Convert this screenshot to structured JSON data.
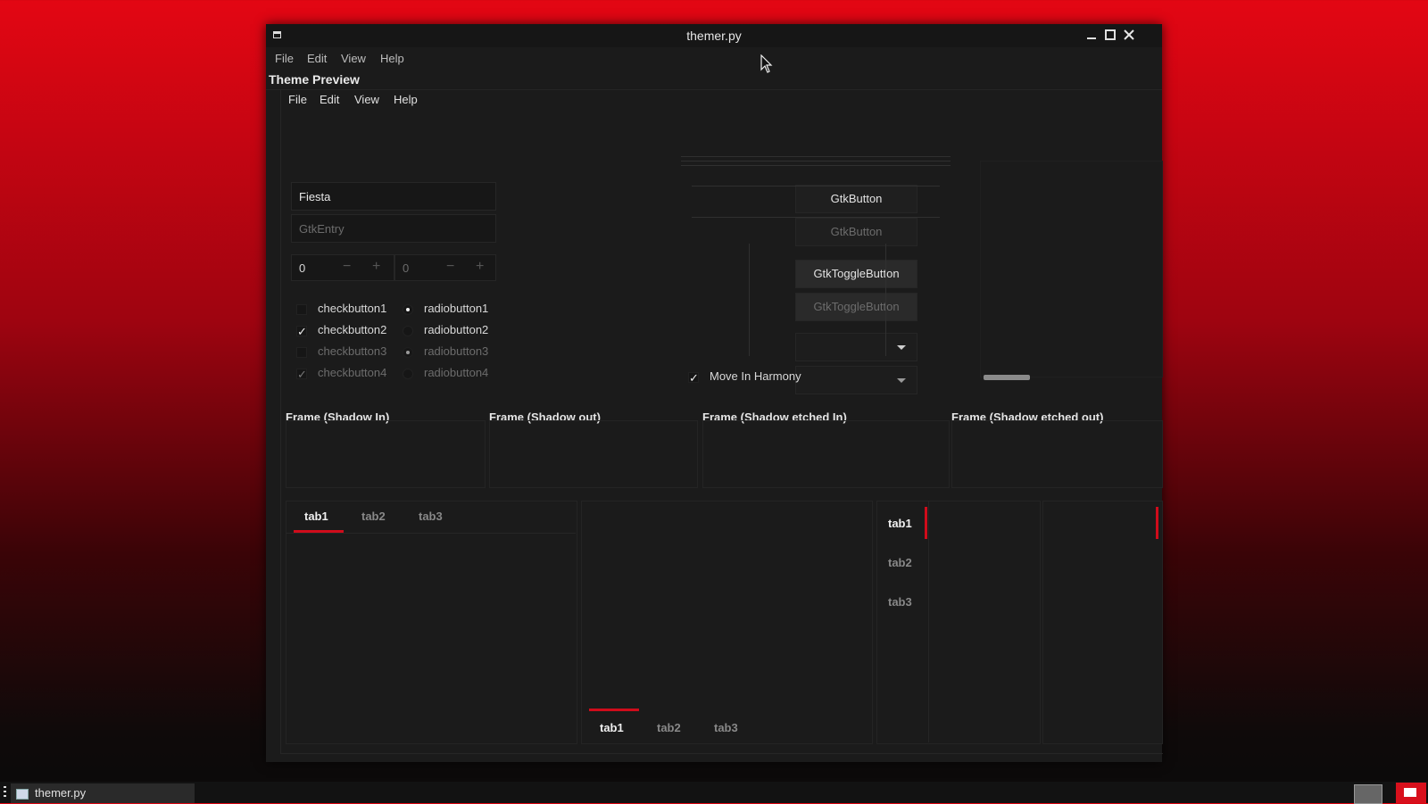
{
  "window": {
    "title": "themer.py"
  },
  "menubar": [
    "File",
    "Edit",
    "View",
    "Help"
  ],
  "preview": {
    "title": "Theme Preview",
    "menubar": [
      "File",
      "Edit",
      "View",
      "Help"
    ],
    "entries": {
      "entry1_value": "Fiesta",
      "entry2_placeholder": "GtkEntry"
    },
    "spinbuttons": [
      {
        "value": "0"
      },
      {
        "value": "0"
      }
    ],
    "checkbuttons": [
      {
        "label": "checkbutton1",
        "checked": false,
        "enabled": true
      },
      {
        "label": "checkbutton2",
        "checked": true,
        "enabled": true
      },
      {
        "label": "checkbutton3",
        "checked": false,
        "enabled": false
      },
      {
        "label": "checkbutton4",
        "checked": true,
        "enabled": false
      }
    ],
    "radiobuttons": [
      {
        "label": "radiobutton1",
        "selected": true,
        "enabled": true
      },
      {
        "label": "radiobutton2",
        "selected": false,
        "enabled": true
      },
      {
        "label": "radiobutton3",
        "selected": true,
        "enabled": false
      },
      {
        "label": "radiobutton4",
        "selected": false,
        "enabled": false
      }
    ],
    "buttons": [
      "GtkButton",
      "GtkButton"
    ],
    "toggle_buttons": [
      "GtkToggleButton",
      "GtkToggleButton"
    ],
    "harmony_check": {
      "label": "Move In Harmony",
      "checked": true
    },
    "frames": [
      "Frame (Shadow In)",
      "Frame (Shadow out)",
      "Frame (Shadow etched In)",
      "Frame (Shadow etched out)"
    ],
    "notebooks": {
      "top": [
        "tab1",
        "tab2",
        "tab3"
      ],
      "bottom": [
        "tab1",
        "tab2",
        "tab3"
      ],
      "left": [
        "tab1",
        "tab2",
        "tab3"
      ]
    }
  },
  "taskbar": {
    "task_label": "themer.py"
  },
  "colors": {
    "accent": "#d00c1b",
    "window_bg": "#1b1b1b",
    "desktop_top": "#e30613"
  }
}
